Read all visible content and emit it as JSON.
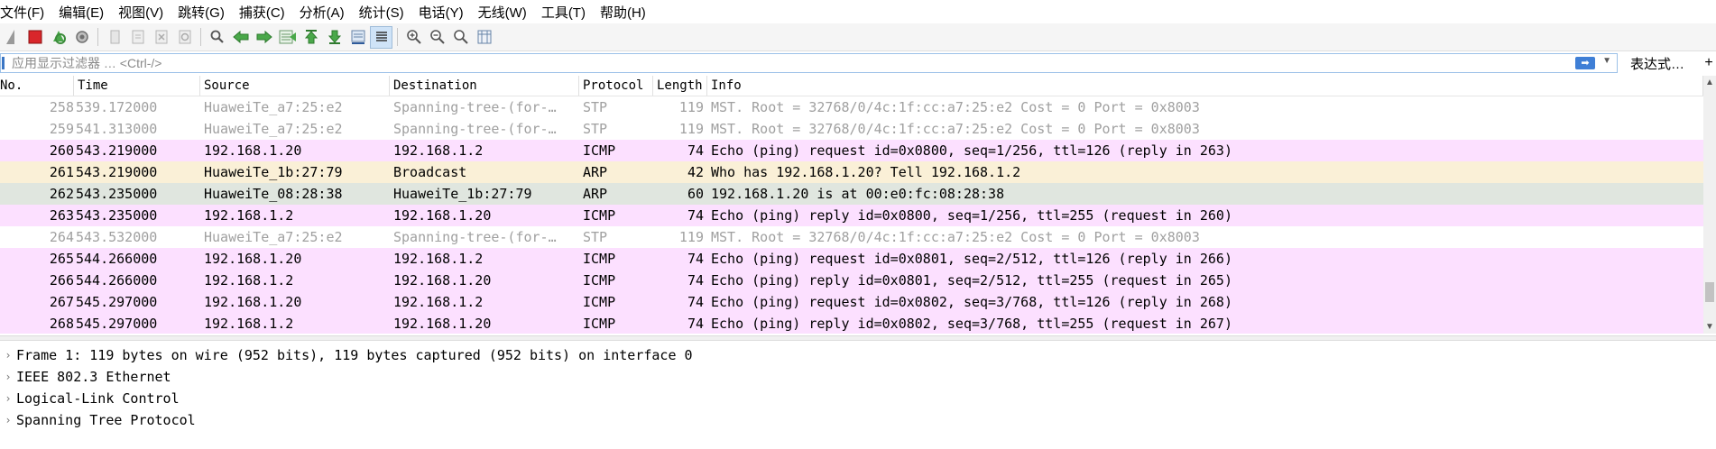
{
  "menu": [
    "文件(F)",
    "编辑(E)",
    "视图(V)",
    "跳转(G)",
    "捕获(C)",
    "分析(A)",
    "统计(S)",
    "电话(Y)",
    "无线(W)",
    "工具(T)",
    "帮助(H)"
  ],
  "filter": {
    "placeholder": "应用显示过滤器 … <Ctrl-/>",
    "expression_label": "表达式…",
    "add_label": "+"
  },
  "columns": {
    "no": "No.",
    "time": "Time",
    "source": "Source",
    "destination": "Destination",
    "protocol": "Protocol",
    "length": "Length",
    "info": "Info"
  },
  "colors": {
    "icmp": "#fce0ff",
    "arp": "#faf0d7",
    "arp_reply": "#e0e6df",
    "stp": "#ffffff",
    "selection_accent": "#3b76c4"
  },
  "packets": [
    {
      "no": "258",
      "time": "539.172000",
      "source": "HuaweiTe_a7:25:e2",
      "destination": "Spanning-tree-(for-…",
      "protocol": "STP",
      "length": "119",
      "info": "MST. Root = 32768/0/4c:1f:cc:a7:25:e2  Cost = 0  Port = 0x8003",
      "style": "stp"
    },
    {
      "no": "259",
      "time": "541.313000",
      "source": "HuaweiTe_a7:25:e2",
      "destination": "Spanning-tree-(for-…",
      "protocol": "STP",
      "length": "119",
      "info": "MST. Root = 32768/0/4c:1f:cc:a7:25:e2  Cost = 0  Port = 0x8003",
      "style": "stp"
    },
    {
      "no": "260",
      "time": "543.219000",
      "source": "192.168.1.20",
      "destination": "192.168.1.2",
      "protocol": "ICMP",
      "length": "74",
      "info": "Echo (ping) request  id=0x0800, seq=1/256, ttl=126 (reply in 263)",
      "style": "icmp"
    },
    {
      "no": "261",
      "time": "543.219000",
      "source": "HuaweiTe_1b:27:79",
      "destination": "Broadcast",
      "protocol": "ARP",
      "length": "42",
      "info": "Who has 192.168.1.20? Tell 192.168.1.2",
      "style": "arp"
    },
    {
      "no": "262",
      "time": "543.235000",
      "source": "HuaweiTe_08:28:38",
      "destination": "HuaweiTe_1b:27:79",
      "protocol": "ARP",
      "length": "60",
      "info": "192.168.1.20 is at 00:e0:fc:08:28:38",
      "style": "arp_reply"
    },
    {
      "no": "263",
      "time": "543.235000",
      "source": "192.168.1.2",
      "destination": "192.168.1.20",
      "protocol": "ICMP",
      "length": "74",
      "info": "Echo (ping) reply    id=0x0800, seq=1/256, ttl=255 (request in 260)",
      "style": "icmp"
    },
    {
      "no": "264",
      "time": "543.532000",
      "source": "HuaweiTe_a7:25:e2",
      "destination": "Spanning-tree-(for-…",
      "protocol": "STP",
      "length": "119",
      "info": "MST. Root = 32768/0/4c:1f:cc:a7:25:e2  Cost = 0  Port = 0x8003",
      "style": "stp"
    },
    {
      "no": "265",
      "time": "544.266000",
      "source": "192.168.1.20",
      "destination": "192.168.1.2",
      "protocol": "ICMP",
      "length": "74",
      "info": "Echo (ping) request  id=0x0801, seq=2/512, ttl=126 (reply in 266)",
      "style": "icmp"
    },
    {
      "no": "266",
      "time": "544.266000",
      "source": "192.168.1.2",
      "destination": "192.168.1.20",
      "protocol": "ICMP",
      "length": "74",
      "info": "Echo (ping) reply    id=0x0801, seq=2/512, ttl=255 (request in 265)",
      "style": "icmp"
    },
    {
      "no": "267",
      "time": "545.297000",
      "source": "192.168.1.20",
      "destination": "192.168.1.2",
      "protocol": "ICMP",
      "length": "74",
      "info": "Echo (ping) request  id=0x0802, seq=3/768, ttl=126 (reply in 268)",
      "style": "icmp"
    },
    {
      "no": "268",
      "time": "545.297000",
      "source": "192.168.1.2",
      "destination": "192.168.1.20",
      "protocol": "ICMP",
      "length": "74",
      "info": "Echo (ping) reply    id=0x0802, seq=3/768, ttl=255 (request in 267)",
      "style": "icmp"
    }
  ],
  "details": [
    "Frame 1: 119 bytes on wire (952 bits), 119 bytes captured (952 bits) on interface 0",
    "IEEE 802.3 Ethernet",
    "Logical-Link Control",
    "Spanning Tree Protocol"
  ],
  "toolbar_icons": [
    "shark-fin-start-icon",
    "stop-capture-icon",
    "restart-capture-icon",
    "capture-options-icon",
    "open-file-icon",
    "save-file-icon",
    "close-file-icon",
    "reload-file-icon",
    "find-packet-icon",
    "go-back-icon",
    "go-forward-icon",
    "go-to-packet-icon",
    "go-first-icon",
    "go-last-icon",
    "autoscroll-icon",
    "colorize-icon",
    "zoom-in-icon",
    "zoom-out-icon",
    "zoom-reset-icon",
    "resize-columns-icon"
  ]
}
